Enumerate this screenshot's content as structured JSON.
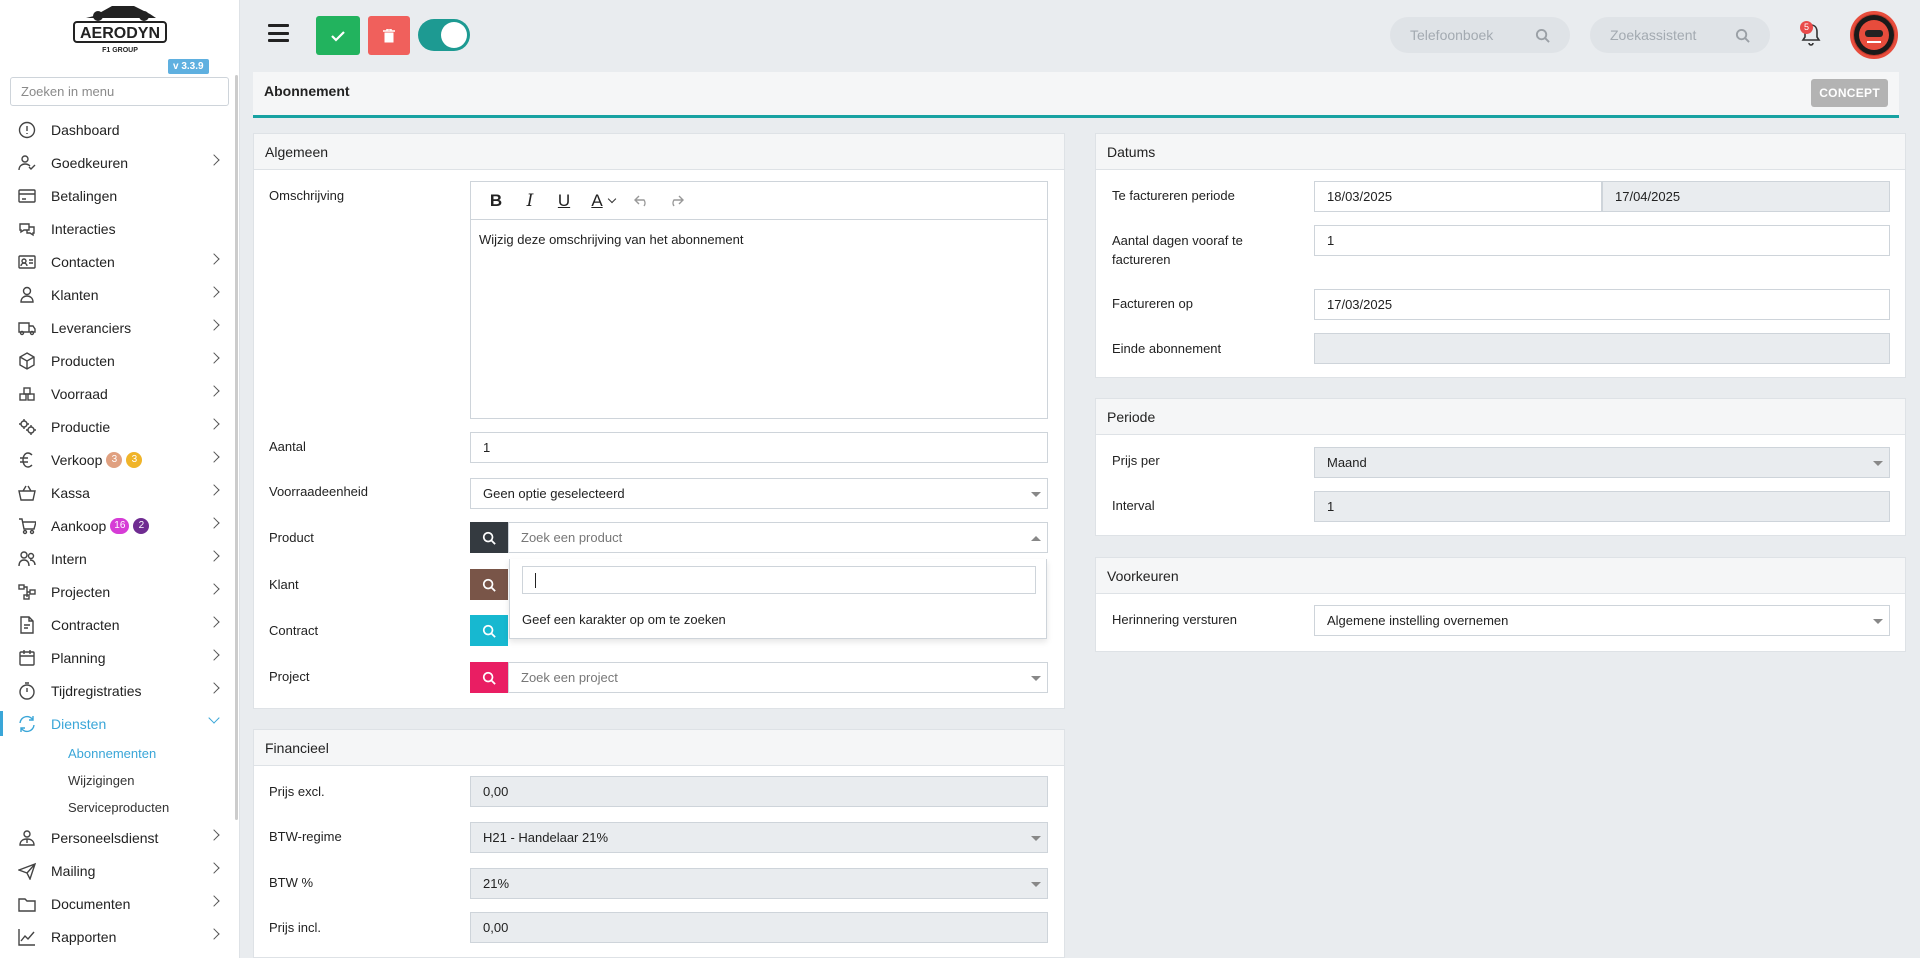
{
  "app": {
    "logo_text": "AERODYN",
    "logo_subtext": "F1 GROUP",
    "version": "v 3.3.9"
  },
  "sidebar": {
    "search_placeholder": "Zoeken in menu",
    "items": [
      {
        "label": "Dashboard",
        "icon": "dashboard-icon",
        "chevron": false
      },
      {
        "label": "Goedkeuren",
        "icon": "user-check-icon",
        "chevron": true
      },
      {
        "label": "Betalingen",
        "icon": "credit-card-icon",
        "chevron": false
      },
      {
        "label": "Interacties",
        "icon": "chat-icon",
        "chevron": false
      },
      {
        "label": "Contacten",
        "icon": "contact-card-icon",
        "chevron": true
      },
      {
        "label": "Klanten",
        "icon": "customer-icon",
        "chevron": true
      },
      {
        "label": "Leveranciers",
        "icon": "truck-icon",
        "chevron": true
      },
      {
        "label": "Producten",
        "icon": "box-icon",
        "chevron": true
      },
      {
        "label": "Voorraad",
        "icon": "boxes-icon",
        "chevron": true
      },
      {
        "label": "Productie",
        "icon": "gears-icon",
        "chevron": true
      },
      {
        "label": "Verkoop",
        "icon": "euro-icon",
        "chevron": true,
        "badges": [
          {
            "text": "3",
            "color": "#e0a080"
          },
          {
            "text": "3",
            "color": "#f0b429"
          }
        ]
      },
      {
        "label": "Kassa",
        "icon": "basket-icon",
        "chevron": true
      },
      {
        "label": "Aankoop",
        "icon": "cart-icon",
        "chevron": true,
        "badges": [
          {
            "text": "16",
            "color": "#d63cd6"
          },
          {
            "text": "2",
            "color": "#6f2c91"
          }
        ]
      },
      {
        "label": "Intern",
        "icon": "users-icon",
        "chevron": true
      },
      {
        "label": "Projecten",
        "icon": "project-icon",
        "chevron": true
      },
      {
        "label": "Contracten",
        "icon": "contract-icon",
        "chevron": true
      },
      {
        "label": "Planning",
        "icon": "calendar-icon",
        "chevron": true
      },
      {
        "label": "Tijdregistraties",
        "icon": "timer-icon",
        "chevron": true
      },
      {
        "label": "Diensten",
        "icon": "refresh-icon",
        "chevron": true,
        "active": true,
        "expanded": true
      }
    ],
    "diensten_sub": [
      "Abonnementen",
      "Wijzigingen",
      "Serviceproducten"
    ],
    "items_after": [
      {
        "label": "Personeelsdienst",
        "icon": "staff-icon",
        "chevron": true
      },
      {
        "label": "Mailing",
        "icon": "send-icon",
        "chevron": true
      },
      {
        "label": "Documenten",
        "icon": "folder-icon",
        "chevron": true
      },
      {
        "label": "Rapporten",
        "icon": "chart-line-icon",
        "chevron": true
      }
    ]
  },
  "topbar": {
    "phonebook_placeholder": "Telefoonboek",
    "assistant_placeholder": "Zoekassistent",
    "notification_count": "5"
  },
  "page": {
    "title": "Abonnement",
    "status": "CONCEPT"
  },
  "algemeen": {
    "heading": "Algemeen",
    "omschrijving_label": "Omschrijving",
    "omschrijving_value": "Wijzig deze omschrijving van het abonnement",
    "aantal_label": "Aantal",
    "aantal_value": "1",
    "voorraadeenheid_label": "Voorraadeenheid",
    "voorraadeenheid_value": "Geen optie geselecteerd",
    "product_label": "Product",
    "product_placeholder": "Zoek een product",
    "klant_label": "Klant",
    "contract_label": "Contract",
    "project_label": "Project",
    "project_placeholder": "Zoek een project",
    "dropdown_message": "Geef een karakter op om te zoeken"
  },
  "financieel": {
    "heading": "Financieel",
    "prijs_excl_label": "Prijs excl.",
    "prijs_excl_value": "0,00",
    "btw_regime_label": "BTW-regime",
    "btw_regime_value": "H21 - Handelaar 21%",
    "btw_pct_label": "BTW %",
    "btw_pct_value": "21%",
    "prijs_incl_label": "Prijs incl.",
    "prijs_incl_value": "0,00"
  },
  "datums": {
    "heading": "Datums",
    "periode_label": "Te factureren periode",
    "periode_start": "18/03/2025",
    "periode_end": "17/04/2025",
    "dagen_label": "Aantal dagen vooraf te factureren",
    "dagen_value": "1",
    "factureren_op_label": "Factureren op",
    "factureren_op_value": "17/03/2025",
    "einde_label": "Einde abonnement",
    "einde_value": ""
  },
  "periode": {
    "heading": "Periode",
    "prijs_per_label": "Prijs per",
    "prijs_per_value": "Maand",
    "interval_label": "Interval",
    "interval_value": "1"
  },
  "voorkeuren": {
    "heading": "Voorkeuren",
    "herinnering_label": "Herinnering versturen",
    "herinnering_value": "Algemene instelling overnemen"
  },
  "colors": {
    "accent": "#3aa6d8",
    "teal": "#17a2a2",
    "ok_green": "#22b35e",
    "delete_red": "#f0605c",
    "product_addon": "#343a40",
    "klant_addon": "#795548",
    "contract_addon": "#17b8d0",
    "project_addon": "#e91e63"
  }
}
